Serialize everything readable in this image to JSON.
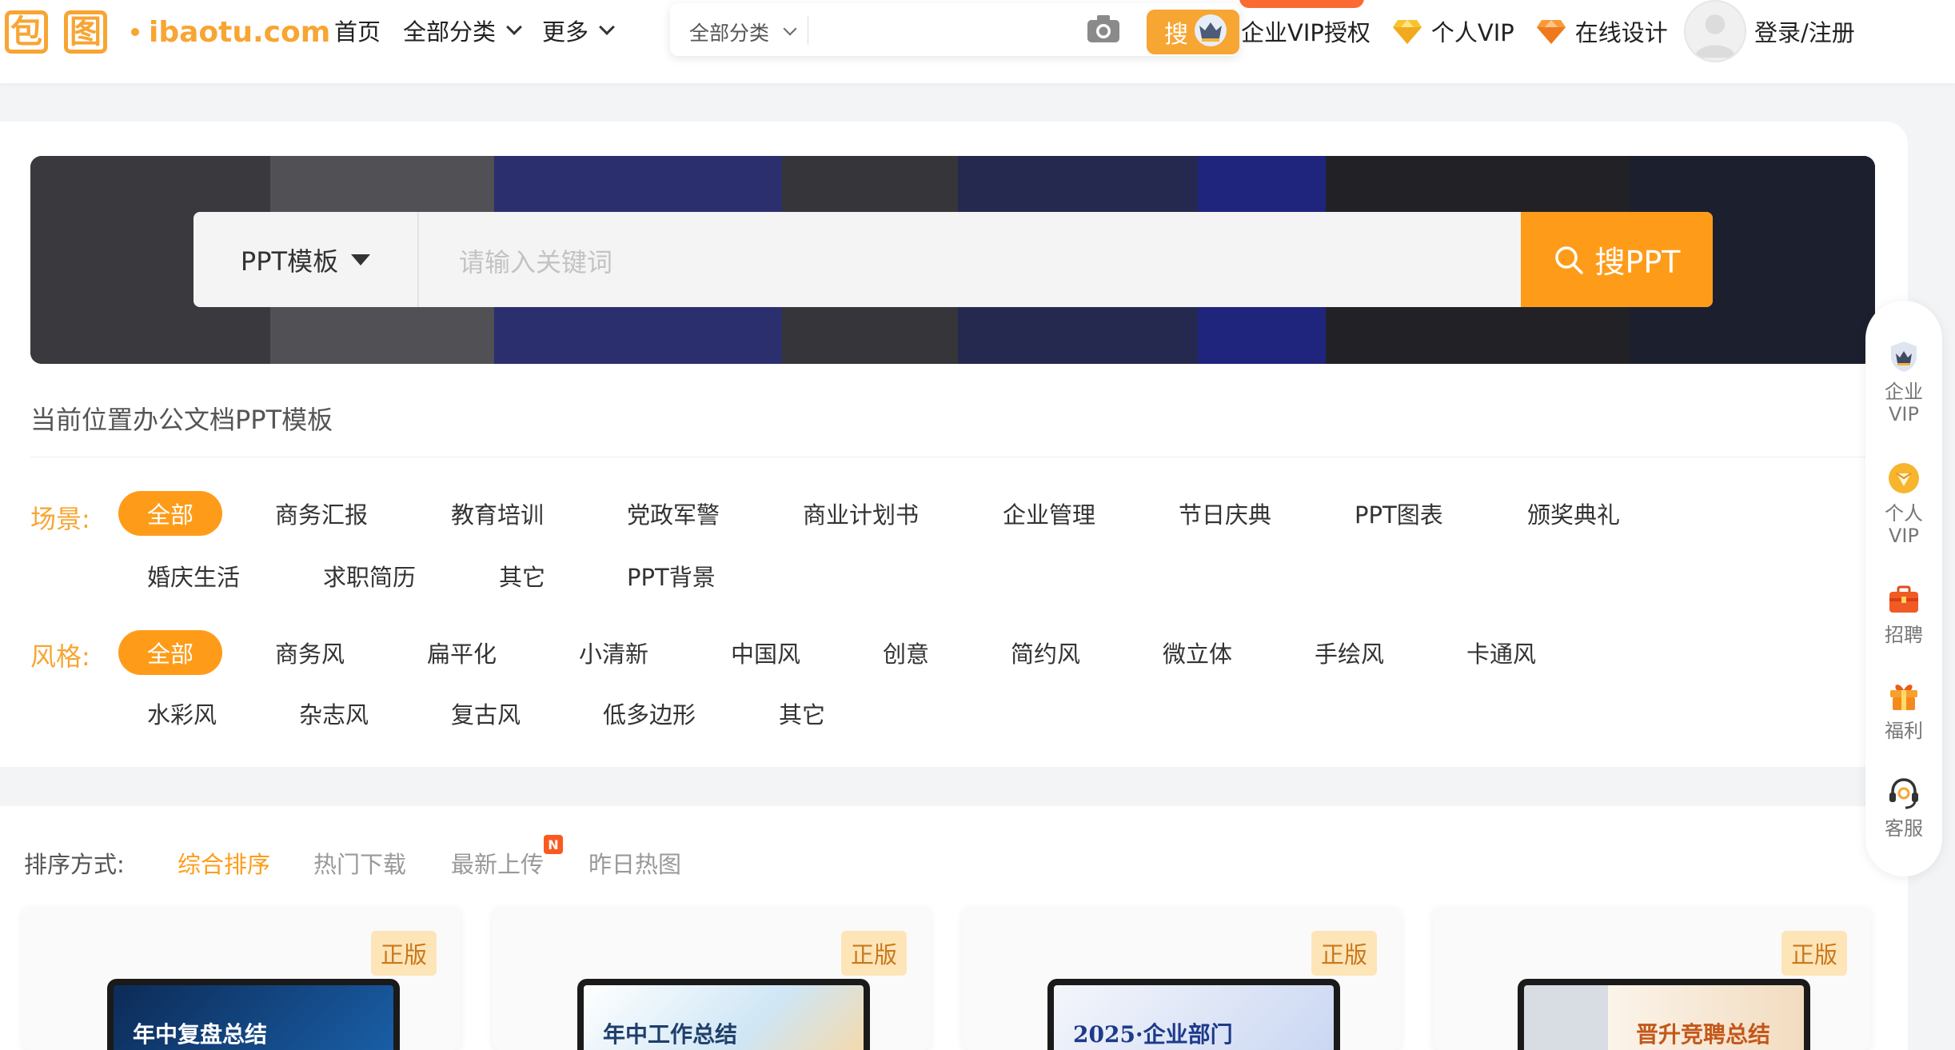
{
  "header": {
    "logo_text": "ibaotu.com",
    "logo_chars": [
      "包",
      "图"
    ],
    "nav": [
      {
        "label": "首页",
        "dropdown": false
      },
      {
        "label": "全部分类",
        "dropdown": true
      },
      {
        "label": "更多",
        "dropdown": true
      }
    ],
    "search": {
      "category": "全部分类",
      "button_label": "搜"
    },
    "vip_links": [
      {
        "label": "企业VIP授权",
        "icon": "crown-shield-icon"
      },
      {
        "label": "个人VIP",
        "icon": "gold-gem-icon"
      },
      {
        "label": "在线设计",
        "icon": "orange-gem-icon"
      }
    ],
    "login_label": "登录/注册"
  },
  "banner_search": {
    "type_label": "PPT模板",
    "placeholder": "请输入关键词",
    "button_label": "搜PPT"
  },
  "breadcrumb": "当前位置办公文档PPT模板",
  "filters": {
    "scene": {
      "label": "场景:",
      "tags": [
        "全部",
        "商务汇报",
        "教育培训",
        "党政军警",
        "商业计划书",
        "企业管理",
        "节日庆典",
        "PPT图表",
        "颁奖典礼",
        "婚庆生活",
        "求职简历",
        "其它",
        "PPT背景"
      ],
      "active": "全部"
    },
    "style": {
      "label": "风格:",
      "tags": [
        "全部",
        "商务风",
        "扁平化",
        "小清新",
        "中国风",
        "创意",
        "简约风",
        "微立体",
        "手绘风",
        "卡通风",
        "水彩风",
        "杂志风",
        "复古风",
        "低多边形",
        "其它"
      ],
      "active": "全部"
    }
  },
  "sort": {
    "label": "排序方式:",
    "options": [
      "综合排序",
      "热门下载",
      "最新上传",
      "昨日热图"
    ],
    "active": "综合排序",
    "new_badge": "N"
  },
  "cards": [
    {
      "badge": "正版",
      "title": "年中复盘总结",
      "theme": "#0e3a6e",
      "title_color": "#ffffff"
    },
    {
      "badge": "正版",
      "title": "年中工作总结",
      "theme": "#eaf4fb",
      "title_color": "#1f3f6b"
    },
    {
      "badge": "正版",
      "title": "2025·企业部门",
      "theme": "#dfe7f7",
      "title_color": "#1e3a8a"
    },
    {
      "badge": "正版",
      "title": "晋升竞聘总结",
      "theme": "#f7efe4",
      "title_color": "#c3581a"
    }
  ],
  "sidebar": [
    {
      "label": "企业\nVIP",
      "icon": "enterprise-vip-icon"
    },
    {
      "label": "个人\nVIP",
      "icon": "personal-vip-icon"
    },
    {
      "label": "招聘",
      "icon": "briefcase-icon"
    },
    {
      "label": "福利",
      "icon": "gift-icon"
    },
    {
      "label": "客服",
      "icon": "headset-icon"
    }
  ],
  "colors": {
    "accent": "#fe9c1a",
    "logo": "#f7a533",
    "page_bg": "#f3f4f6"
  }
}
